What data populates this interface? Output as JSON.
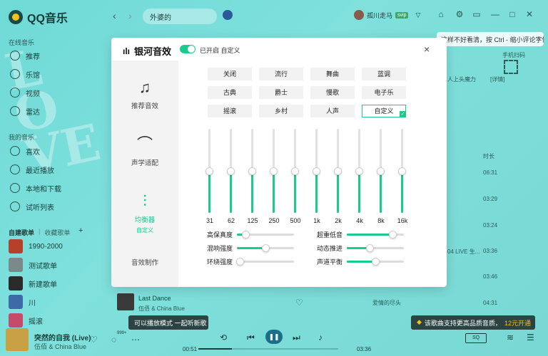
{
  "app": {
    "title": "QQ音乐"
  },
  "sidebar": {
    "online_title": "在线音乐",
    "online_items": [
      {
        "label": "推荐",
        "icon": "home-icon"
      },
      {
        "label": "乐馆",
        "icon": "compass-icon"
      },
      {
        "label": "视频",
        "icon": "video-icon"
      },
      {
        "label": "雷达",
        "icon": "radar-icon"
      }
    ],
    "my_title": "我的音乐",
    "my_items": [
      {
        "label": "喜欢",
        "icon": "heart-icon"
      },
      {
        "label": "最近播放",
        "icon": "clock-icon"
      },
      {
        "label": "本地和下载",
        "icon": "download-icon"
      },
      {
        "label": "试听列表",
        "icon": "list-icon"
      }
    ],
    "playlists_tab": "自建歌单",
    "collected_tab": "收藏歌单",
    "add_icon": "+",
    "playlists": [
      {
        "label": "1990-2000",
        "color": "#b5412d"
      },
      {
        "label": "测试歌单",
        "color": "#7a8a8a"
      },
      {
        "label": "新建歌单",
        "color": "#2a2a2a"
      },
      {
        "label": "川",
        "color": "#3e6aa8"
      },
      {
        "label": "摇滚",
        "color": "#c64a6a"
      }
    ]
  },
  "topbar": {
    "back": "‹",
    "forward": "›",
    "search_value": "外婆的",
    "user_name": "孤川走马",
    "badge": "svip",
    "icons": [
      "shirt-icon",
      "settings-icon",
      "mini-mode-icon",
      "minimize-icon",
      "maximize-icon",
      "close-icon"
    ]
  },
  "background": {
    "tip_text": "这样不好看清，按 Ctrl - 缩小评论字体",
    "phone_label": "手机扫码",
    "detail_label": "[详情]",
    "frag_text": "人上头魔力",
    "duration_header": "时长",
    "durations": [
      "06:31",
      "03:29",
      "03:24",
      "03:36",
      "03:46",
      "04:31"
    ],
    "live_frag": "04 LIVE 生...",
    "song_title": "Last Dance",
    "song_artist": "伍佰 & China Blue",
    "song_album": "爱情的尽头"
  },
  "modal": {
    "title": "银河音效",
    "toggle_text": "已开启 自定义",
    "close": "×",
    "side_items": [
      {
        "label": "推荐音效",
        "icon": "music-note-icon",
        "active": false
      },
      {
        "label": "声学适配",
        "icon": "headphones-icon",
        "active": false
      },
      {
        "label": "均衡器",
        "sub": "自定义",
        "icon": "equalizer-icon",
        "active": true
      },
      {
        "label": "音效制作",
        "icon": "",
        "active": false
      }
    ],
    "presets": [
      [
        "关闭",
        "流行",
        "舞曲",
        "蓝调"
      ],
      [
        "古典",
        "爵士",
        "慢歌",
        "电子乐"
      ],
      [
        "摇滚",
        "乡村",
        "人声",
        "自定义"
      ]
    ],
    "selected_preset": "自定义",
    "eq_bands": [
      {
        "label": "31",
        "level": 0.5
      },
      {
        "label": "62",
        "level": 0.5
      },
      {
        "label": "125",
        "level": 0.5
      },
      {
        "label": "250",
        "level": 0.5
      },
      {
        "label": "500",
        "level": 0.5
      },
      {
        "label": "1k",
        "level": 0.5
      },
      {
        "label": "2k",
        "level": 0.5
      },
      {
        "label": "4k",
        "level": 0.5
      },
      {
        "label": "8k",
        "level": 0.5
      },
      {
        "label": "16k",
        "level": 0.5
      }
    ],
    "effects_left": [
      {
        "label": "高保真度",
        "level": 0.15
      },
      {
        "label": "混响强度",
        "level": 0.5
      },
      {
        "label": "环绕强度",
        "level": 0.05
      }
    ],
    "effects_right": [
      {
        "label": "超重低音",
        "level": 0.8
      },
      {
        "label": "动态推进",
        "level": 0.4
      },
      {
        "label": "声道平衡",
        "level": 0.5
      }
    ]
  },
  "player": {
    "song": "突然的自我 (Live)",
    "artist": "伍佰 & China Blue",
    "comment_count": "999+",
    "toast_left": "可以播放模式 一起听新歌",
    "toast_right": "该歌曲支持更高品质音质，",
    "toast_right_link": "12元开通",
    "time_current": "00:51",
    "time_total": "03:36",
    "progress": 0.24
  }
}
